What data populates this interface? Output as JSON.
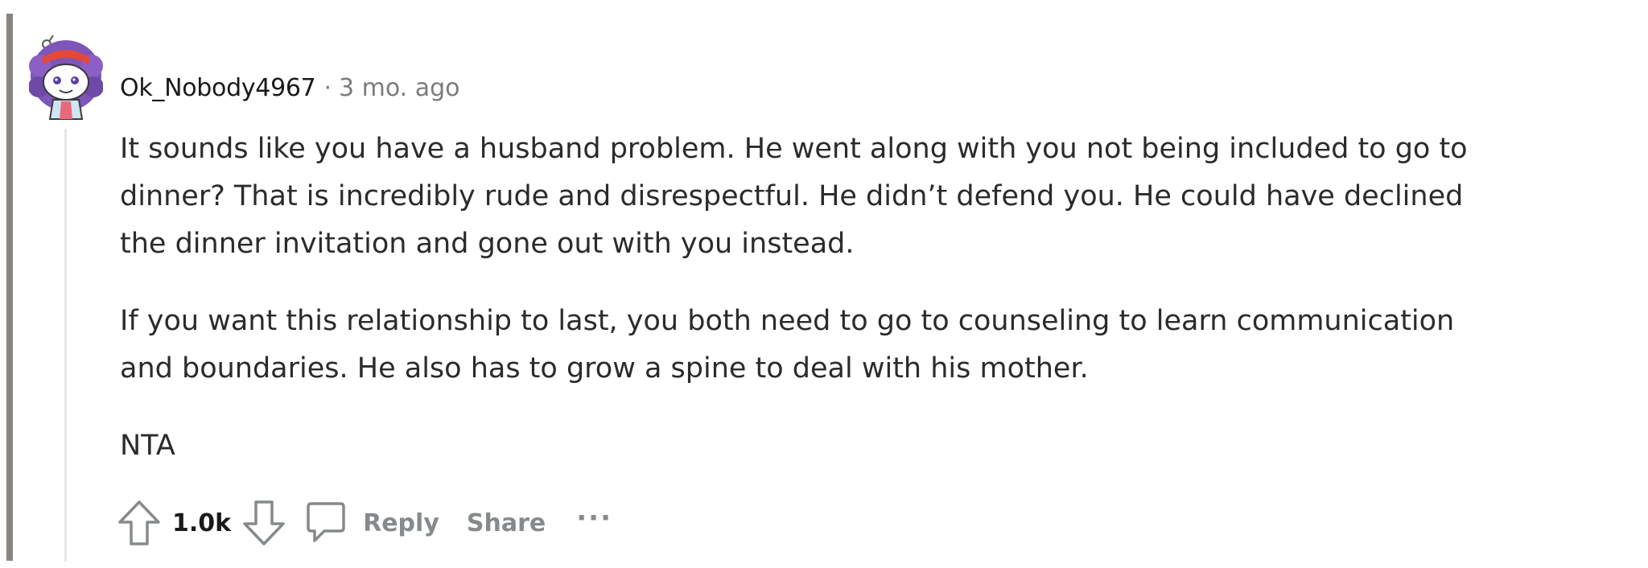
{
  "comment": {
    "author": "Ok_Nobody4967",
    "separator": "·",
    "age": "3 mo. ago",
    "paragraphs": [
      [
        "It sounds like you have a husband problem. He went along with you not being included to go to",
        "dinner? That is incredibly rude and disrespectful. He didn’t defend you. He could have declined",
        "the dinner invitation and gone out with you instead."
      ],
      [
        "If you want this relationship to last, you both need to go to counseling to learn communication",
        "and boundaries. He also has to grow a spine to deal with his mother."
      ],
      [
        "NTA"
      ]
    ]
  },
  "actions": {
    "upvote_icon": "arrow-up-outline-icon",
    "score": "1.0k",
    "downvote_icon": "arrow-down-outline-icon",
    "reply_icon": "chat-bubble-icon",
    "reply_label": "Reply",
    "share_label": "Share",
    "more_label": "···"
  },
  "colors": {
    "thread_bar": "#8b8580",
    "thread_line": "#e4e6e8",
    "meta_gray": "#7c7c7c",
    "action_gray": "#878a8c",
    "text": "#2b2b2b"
  }
}
